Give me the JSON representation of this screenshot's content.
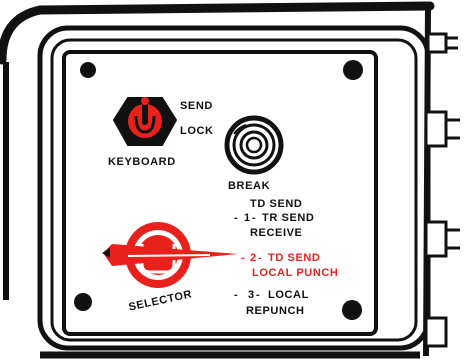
{
  "colors": {
    "ink": "#111111",
    "accent_red": "#e8211c",
    "panel_face": "#ffffff"
  },
  "keyboard_switch": {
    "positions": {
      "top": "SEND",
      "middle": "LOCK"
    },
    "name_label": "KEYBOARD",
    "icon": "rotary-switch-icon"
  },
  "break_button": {
    "label": "BREAK",
    "icon": "push-button-icon"
  },
  "selector_switch": {
    "name_label": "SELECTOR",
    "icon": "rotary-selector-knob-icon",
    "header_line": "TD SEND",
    "positions": [
      {
        "marker": "-",
        "number": "1",
        "line1": "TR SEND",
        "line2": "RECEIVE",
        "selected": false
      },
      {
        "marker": "-",
        "number": "2",
        "line1": "TD SEND",
        "line2": "LOCAL PUNCH",
        "selected": true
      },
      {
        "marker": "-",
        "number": "3",
        "line1": "LOCAL",
        "line2": "REPUNCH",
        "selected": false
      }
    ]
  },
  "hardware": {
    "screw_icon": "screw-head-icon",
    "latch_icon": "side-latch-icon"
  }
}
